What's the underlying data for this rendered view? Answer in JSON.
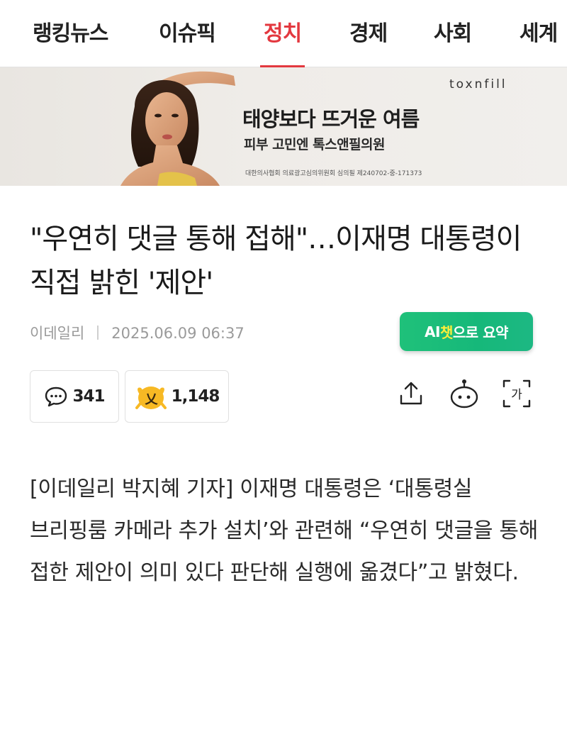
{
  "nav": {
    "tabs": [
      {
        "label": "랭킹뉴스",
        "active": false
      },
      {
        "label": "이슈픽",
        "active": false
      },
      {
        "label": "정치",
        "active": true
      },
      {
        "label": "경제",
        "active": false
      },
      {
        "label": "사회",
        "active": false
      },
      {
        "label": "세계",
        "active": false
      }
    ],
    "active_color": "#e3383f"
  },
  "ad": {
    "brand": "toxnfill",
    "headline": "태양보다 뜨거운 여름",
    "subline": "피부 고민엔 톡스앤필의원",
    "disclaimer": "대한의사협회 의료광고심의위원회 심의필 제240702-중-171373"
  },
  "article": {
    "title": "\"우연히 댓글 통해 접해\"…이재명 대통령이 직접 밝힌 '제안'",
    "source": "이데일리",
    "datetime": "2025.06.09 06:37",
    "body": "[이데일리 박지혜 기자] 이재명 대통령은 ‘대통령실 브리핑룸 카메라 추가 설치’와 관련해 “우연히 댓글을 통해 접한 제안이 의미 있다 판단해 실행에 옮겼다”고 밝혔다."
  },
  "ai_summary": {
    "prefix": "AI",
    "highlight": "챗",
    "suffix": "으로 요약",
    "color": "#1fc17a"
  },
  "actions": {
    "comment_count": "341",
    "reaction_count": "1,148",
    "reaction_glyph": "乂",
    "font_size_glyph": "가",
    "icons": [
      "comment-icon",
      "reaction-emoji-icon",
      "share-icon",
      "chatbot-icon",
      "font-size-icon"
    ]
  }
}
